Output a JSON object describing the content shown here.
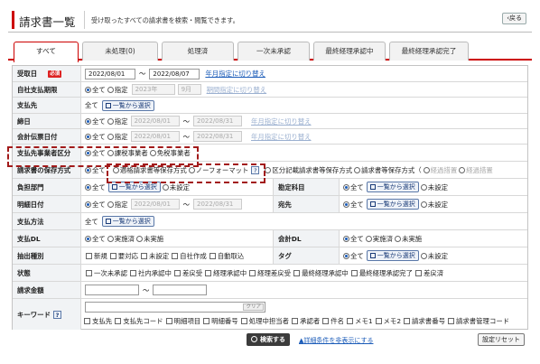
{
  "header": {
    "title": "請求書一覧",
    "description": "受け取ったすべての請求書を検索・閲覧できます。",
    "back": "戻る"
  },
  "tabs": [
    "すべて",
    "未処理(0)",
    "処理済",
    "一次未承認",
    "最終経理承認中",
    "最終経理承認完了"
  ],
  "fields": {
    "received": {
      "label": "受取日",
      "required": "必須",
      "from": "2022/08/01",
      "to": "2022/08/07",
      "link": "年月指定に切り替え"
    },
    "own_payment": {
      "label": "自社支払期限",
      "all": "全て",
      "spec": "指定",
      "year": "2023年",
      "month": "9月",
      "link": "期間指定に切り替え"
    },
    "payee": {
      "label": "支払先",
      "all": "全て",
      "btn": "一覧から選択"
    },
    "deadline": {
      "label": "締日",
      "all": "全て",
      "spec": "指定",
      "from": "2022/08/01",
      "to": "2022/08/31",
      "link": "年月指定に切り替え"
    },
    "voucher": {
      "label": "会計伝票日付",
      "all": "全て",
      "spec": "指定",
      "from": "2022/08/01",
      "to": "2022/08/31",
      "link": "年月指定に切り替え"
    },
    "biz_type": {
      "label": "支払先事業者区分",
      "all": "全て",
      "opt1": "課税事業者",
      "opt2": "免税事業者"
    },
    "save_method": {
      "label": "請求書の保存方式",
      "all": "全て",
      "opt1": "適格請求書等保存方式",
      "opt2": "ノーフォーマット",
      "opt3": "区分記載請求書等保存方式",
      "opt4": "請求書等保存方式（",
      "opt4b": "経過措置",
      "opt4c": "経過措置"
    },
    "dept": {
      "label": "負担部門",
      "all": "全て",
      "btn": "一覧から選択",
      "opt": "未設定"
    },
    "account": {
      "label": "勘定科目",
      "all": "全て",
      "btn": "一覧から選択",
      "opt": "未設定"
    },
    "detail_date": {
      "label": "明細日付",
      "all": "全て",
      "spec": "指定",
      "from": "2022/08/01",
      "to": "2022/08/31"
    },
    "dest": {
      "label": "宛先",
      "all": "全て",
      "btn": "一覧から選択",
      "opt": "未設定"
    },
    "pay_method": {
      "label": "支払方法",
      "all": "全て",
      "btn": "一覧から選択"
    },
    "pay_dl": {
      "label": "支払DL",
      "all": "全て",
      "opt1": "実施済",
      "opt2": "未実施"
    },
    "acct_dl": {
      "label": "会計DL",
      "all": "全て",
      "opt1": "実施済",
      "opt2": "未実施"
    },
    "extract": {
      "label": "抽出種別",
      "opts": [
        "新規",
        "要対応",
        "未設定",
        "自社作成",
        "自動取込"
      ]
    },
    "tag": {
      "label": "タグ",
      "all": "全て",
      "btn": "一覧から選択",
      "opt": "未設定"
    },
    "status": {
      "label": "状態",
      "opts": [
        "一次未承認",
        "社内承認中",
        "差戻受",
        "経理承認中",
        "経理差戻受",
        "最終経理承認中",
        "最終経理承認完了",
        "差戻済"
      ]
    },
    "amount": {
      "label": "請求金額",
      "sep": "～"
    },
    "keyword": {
      "label": "キーワード",
      "help": "?",
      "clear": "クリア",
      "opts": [
        "支払先",
        "支払先コード",
        "明細項目",
        "明細番号",
        "処理中担当者",
        "承認者",
        "件名",
        "メモ1",
        "メモ2",
        "請求書番号",
        "請求書管理コード"
      ]
    }
  },
  "footer": {
    "search": "検索する",
    "advanced": "詳細条件を非表示にする",
    "reset": "設定リセット"
  }
}
